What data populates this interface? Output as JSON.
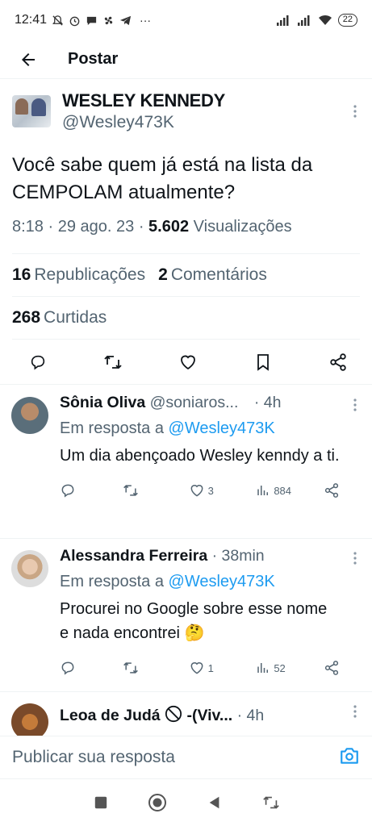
{
  "status_bar": {
    "time": "12:41",
    "extra": "···",
    "battery": "22"
  },
  "header": {
    "title": "Postar"
  },
  "tweet": {
    "author_name": "WESLEY KENNEDY",
    "author_handle": "@Wesley473K",
    "text": "Você sabe quem já está na lista da CEMPOLAM atualmente?",
    "time": "8:18",
    "date": "29 ago. 23",
    "views_count": "5.602",
    "views_label": "Visualizações",
    "reposts_count": "16",
    "reposts_label": "Republicações",
    "comments_count": "2",
    "comments_label": "Comentários",
    "likes_count": "268",
    "likes_label": "Curtidas"
  },
  "replies": [
    {
      "name": "Sônia Oliva",
      "handle": "@soniaros...",
      "time": "· 4h",
      "reply_prefix": "Em resposta a",
      "reply_mention": "@Wesley473K",
      "text": "Um dia abençoado Wesley kenndy a ti.",
      "likes": "3",
      "views": "884"
    },
    {
      "name": "Alessandra Ferreira",
      "handle": "",
      "time": "· 38min",
      "reply_prefix": "Em resposta a",
      "reply_mention": "@Wesley473K",
      "text": "Procurei no Google sobre esse nome e nada encontrei 🤔",
      "likes": "1",
      "views": "52"
    },
    {
      "name": "Leoa de Judá",
      "suffix": "-(Viv...",
      "time": "· 4h"
    }
  ],
  "compose": {
    "placeholder": "Publicar sua resposta"
  },
  "colors": {
    "accent": "#1d9bf0",
    "secondary_text": "#536471",
    "primary_text": "#0f1419",
    "divider": "#eff3f4"
  }
}
